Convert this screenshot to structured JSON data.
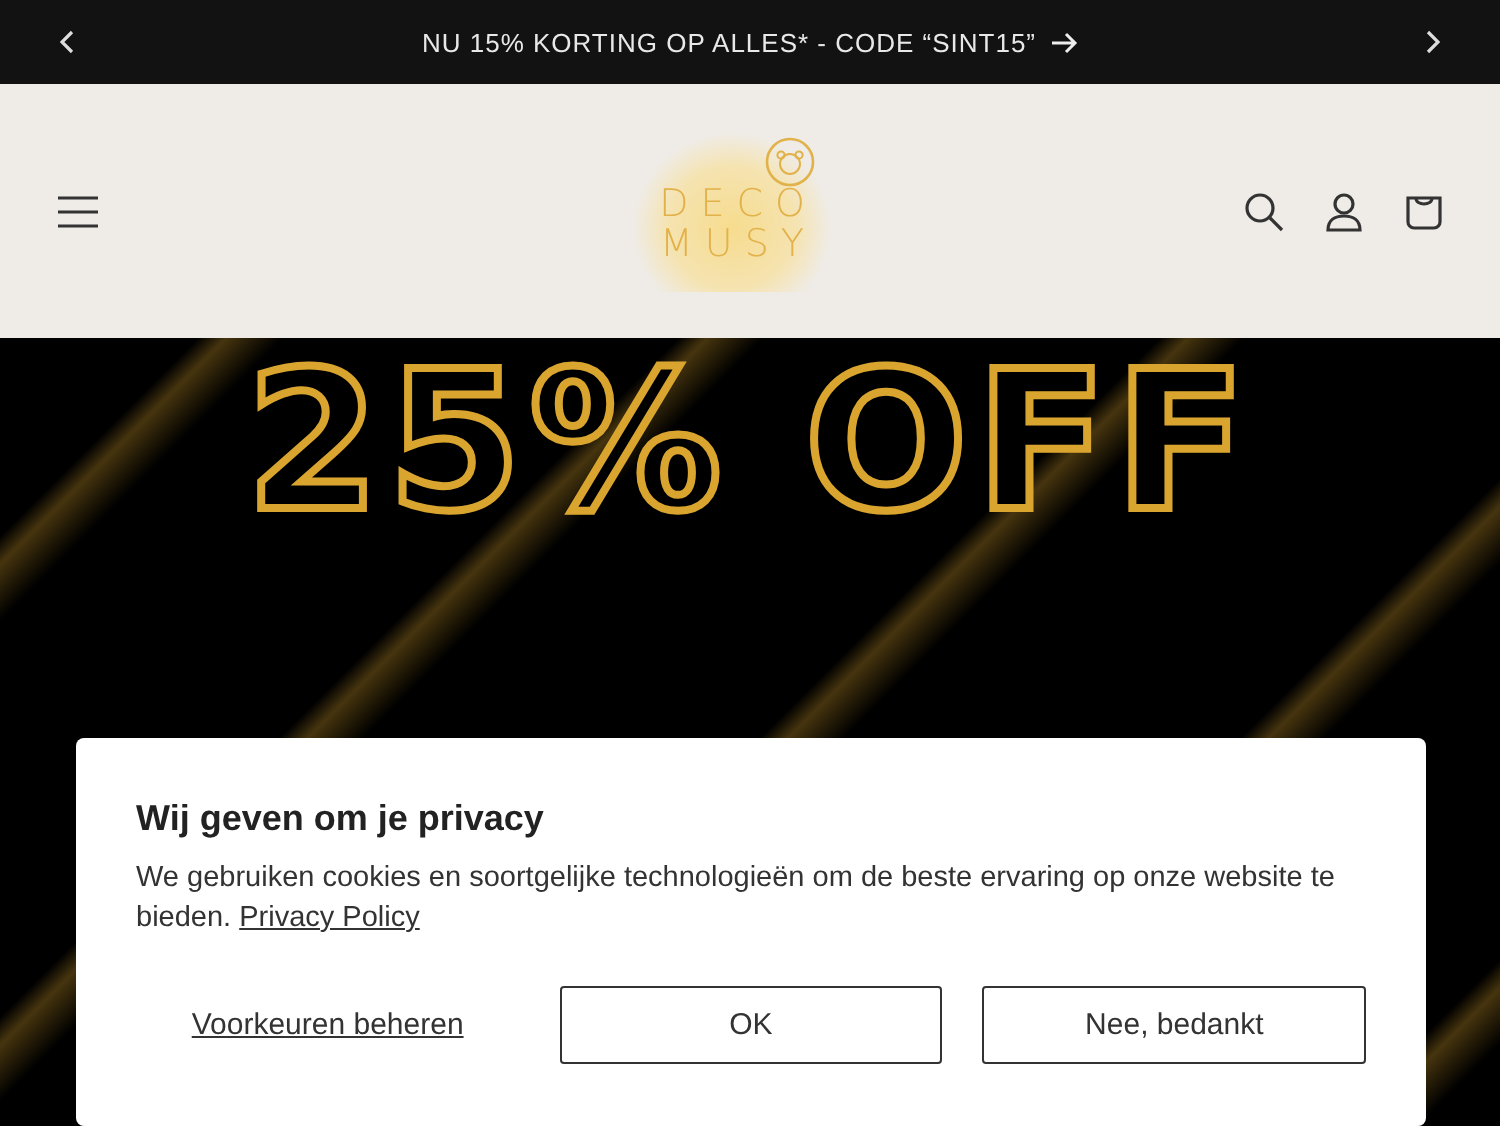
{
  "announcement": {
    "text": "NU 15% KORTING OP ALLES* - CODE “SINT15”"
  },
  "header": {
    "logo": {
      "line_1": "DECO",
      "line_2": "MUSY"
    }
  },
  "hero": {
    "headline": "25% OFF"
  },
  "cookie_dialog": {
    "title": "Wij geven om je privacy",
    "body": "We gebruiken cookies en soortgelijke technologieën om de beste ervaring op onze website te bieden.",
    "link": "Privacy Policy",
    "buttons": [
      {
        "kind": "link",
        "label": "Voorkeuren beheren"
      },
      {
        "kind": "outline",
        "label": "OK"
      },
      {
        "kind": "outline",
        "label": "Nee, bedankt"
      }
    ]
  }
}
